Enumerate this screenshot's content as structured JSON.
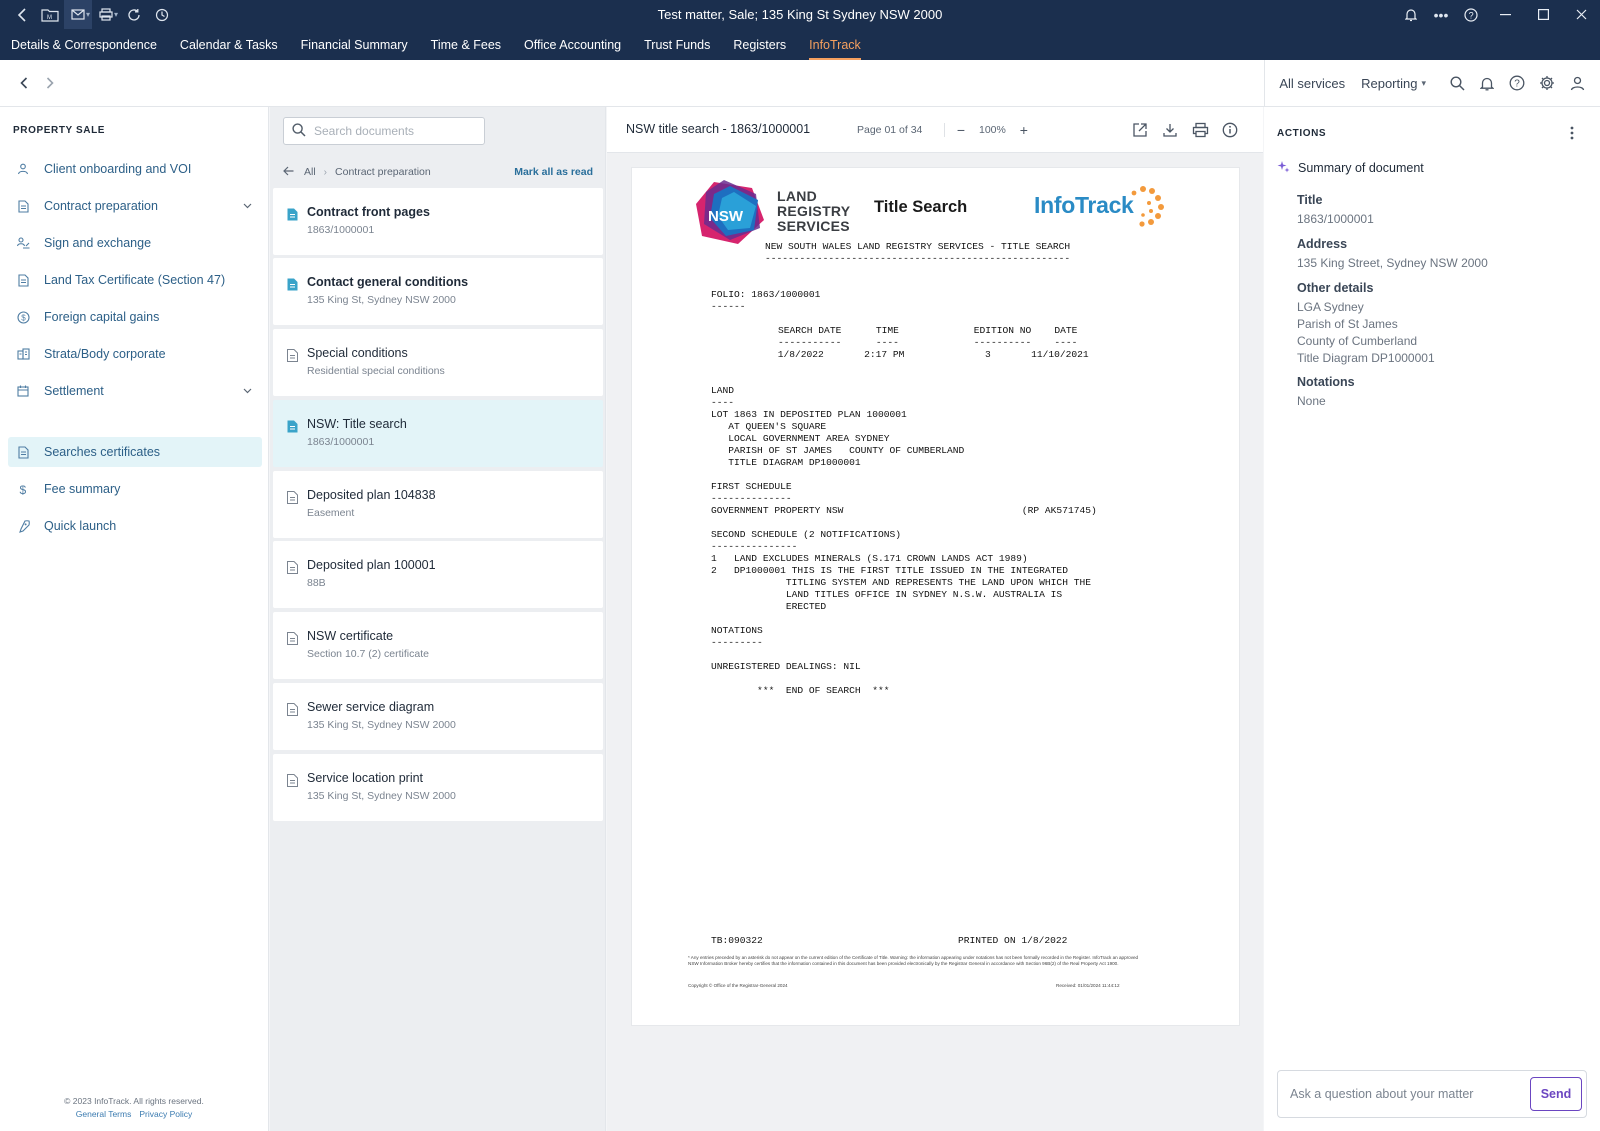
{
  "window": {
    "title": "Test matter,  Sale;  135 King St Sydney NSW 2000"
  },
  "menu": {
    "items": [
      {
        "label": "Details & Correspondence"
      },
      {
        "label": "Calendar & Tasks"
      },
      {
        "label": "Financial Summary"
      },
      {
        "label": "Time & Fees"
      },
      {
        "label": "Office Accounting"
      },
      {
        "label": "Trust Funds"
      },
      {
        "label": "Registers"
      },
      {
        "label": "InfoTrack",
        "active": true
      }
    ]
  },
  "toolbar": {
    "all_services": "All services",
    "reporting": "Reporting"
  },
  "sidebar": {
    "heading": "PROPERTY SALE",
    "items": [
      {
        "label": "Client onboarding and VOI",
        "icon": "person-icon"
      },
      {
        "label": "Contract preparation",
        "icon": "document-icon",
        "expandable": true
      },
      {
        "label": "Sign and exchange",
        "icon": "sign-icon"
      },
      {
        "label": "Land Tax Certificate (Section 47)",
        "icon": "document-icon"
      },
      {
        "label": "Foreign capital gains",
        "icon": "dollar-circle-icon"
      },
      {
        "label": "Strata/Body corporate",
        "icon": "building-icon"
      },
      {
        "label": "Settlement",
        "icon": "calendar-icon",
        "expandable": true
      },
      {
        "label": "Searches certificates",
        "icon": "document-icon",
        "selected": true
      },
      {
        "label": "Fee summary",
        "icon": "dollar-icon"
      },
      {
        "label": "Quick launch",
        "icon": "rocket-icon"
      }
    ],
    "footer": {
      "copyright": "© 2023 InfoTrack. All rights reserved.",
      "terms": "General Terms",
      "privacy": "Privacy Policy"
    }
  },
  "doclist": {
    "search_placeholder": "Search documents",
    "breadcrumb": {
      "root": "All",
      "current": "Contract preparation"
    },
    "mark_all": "Mark all as read",
    "docs": [
      {
        "title": "Contract front pages",
        "sub": "1863/1000001",
        "unread": true
      },
      {
        "title": "Contact general conditions",
        "sub": "135 King St, Sydney NSW 2000",
        "unread": true
      },
      {
        "title": "Special conditions",
        "sub": "Residential special conditions",
        "unread": false
      },
      {
        "title": "NSW: Title search",
        "sub": "1863/1000001",
        "unread": false,
        "selected": true
      },
      {
        "title": "Deposited plan 104838",
        "sub": "Easement",
        "unread": false
      },
      {
        "title": "Deposited plan 100001",
        "sub": "88B",
        "unread": false
      },
      {
        "title": "NSW certificate",
        "sub": "Section 10.7 (2) certificate",
        "unread": false
      },
      {
        "title": "Sewer service diagram",
        "sub": "135 King St, Sydney NSW 2000",
        "unread": false
      },
      {
        "title": "Service location print",
        "sub": "135 King St, Sydney NSW 2000",
        "unread": false
      }
    ]
  },
  "viewer": {
    "title": "NSW title search - 1863/1000001",
    "page_info": "Page 01 of 34",
    "zoom": "100%"
  },
  "document": {
    "nsw_badge": "NSW",
    "lrs": [
      "LAND",
      "REGISTRY",
      "SERVICES"
    ],
    "title": "Title Search",
    "brand": "InfoTrack",
    "header_line": "NEW SOUTH WALES LAND REGISTRY SERVICES - TITLE SEARCH",
    "header_rule": "-----------------------------------------------------",
    "folio": "FOLIO: 1863/1000001",
    "folio_rule": "------",
    "search_cols": "SEARCH DATE      TIME             EDITION NO    DATE",
    "search_rules": "-----------      ----             ----------    ----",
    "search_vals": " 1/8/2022       2:17 PM              3       11/10/2021",
    "land_head": "LAND",
    "land_rule": "----",
    "land_lines": [
      "LOT 1863 IN DEPOSITED PLAN 1000001",
      "   AT QUEEN'S SQUARE",
      "   LOCAL GOVERNMENT AREA SYDNEY",
      "   PARISH OF ST JAMES   COUNTY OF CUMBERLAND",
      "   TITLE DIAGRAM DP1000001"
    ],
    "first_head": "FIRST SCHEDULE",
    "first_rule": "--------------",
    "first_line": "GOVERNMENT PROPERTY NSW                               (RP AK571745)",
    "second_head": "SECOND SCHEDULE (2 NOTIFICATIONS)",
    "second_rule": "---------------",
    "second_lines": [
      "1   LAND EXCLUDES MINERALS (S.171 CROWN LANDS ACT 1989)",
      "2   DP1000001 THIS IS THE FIRST TITLE ISSUED IN THE INTEGRATED",
      "             TITLING SYSTEM AND REPRESENTS THE LAND UPON WHICH THE",
      "             LAND TITLES OFFICE IN SYDNEY N.S.W. AUSTRALIA IS",
      "             ERECTED"
    ],
    "notations_head": "NOTATIONS",
    "notations_rule": "---------",
    "dealings": "UNREGISTERED DEALINGS: NIL",
    "end": "        ***  END OF SEARCH  ***",
    "footer_left": "TB:090322",
    "footer_right": "PRINTED ON 1/8/2022",
    "fine_print": "* Any entries preceded by an asterisk do not appear on the current edition of the Certificate of Title. Warning: the information appearing under notations has not been formally recorded in the Register. InfoTrack an approved NSW Information Broker hereby certifies that the information contained in this document has been provided electronically by the Registrar General in accordance with Section 96B(2) of the Real Property Act 1900.",
    "copyright": "Copyright © Office of the Registrar-General 2024",
    "received": "Received: 01/01/2024 11:44:12"
  },
  "actions": {
    "heading": "ACTIONS",
    "summary": "Summary of document",
    "fields": {
      "title_label": "Title",
      "title_value": "1863/1000001",
      "address_label": "Address",
      "address_value": "135 King Street, Sydney NSW 2000",
      "other_label": "Other details",
      "other_values": [
        "LGA Sydney",
        "Parish of St James",
        "County of Cumberland",
        "Title Diagram DP1000001"
      ],
      "notations_label": "Notations",
      "notations_value": "None"
    },
    "ask_placeholder": "Ask a question about your matter",
    "send": "Send"
  },
  "colors": {
    "nav_bg": "#1b2f4e",
    "active_tab": "#f5a05f",
    "link_blue": "#2c5f87",
    "selected_bg": "#e3f4f8",
    "send_purple": "#6b46c1",
    "infotrack_blue": "#2a8bc5",
    "infotrack_orange": "#f39a3c"
  }
}
